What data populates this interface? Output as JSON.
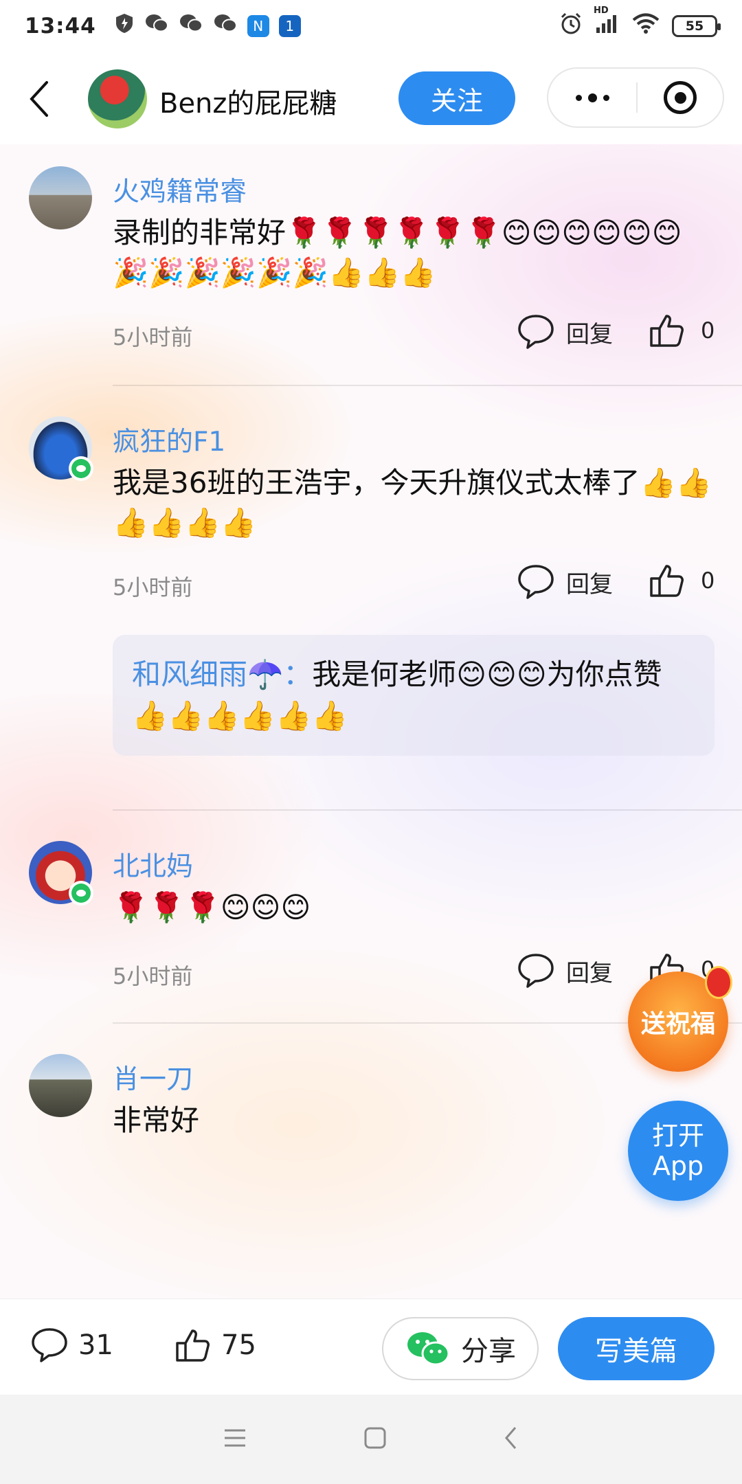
{
  "status_bar": {
    "time": "13:44",
    "battery": "55",
    "signal_label": "HD"
  },
  "header": {
    "back_icon": "chevron-left-icon",
    "author_name": "Benz的屁屁糖",
    "follow_label": "关注",
    "more_icon": "more-dots-icon",
    "close_icon": "target-close-icon"
  },
  "comments": [
    {
      "name": "火鸡籍常睿",
      "text": "录制的非常好🌹🌹🌹🌹🌹🌹😊😊😊😊😊😊🎉🎉🎉🎉🎉🎉👍👍👍",
      "time": "5小时前",
      "reply_label": "回复",
      "likes": "0"
    },
    {
      "name": "疯狂的F1",
      "text": "我是36班的王浩宇，今天升旗仪式太棒了👍👍👍👍👍👍",
      "time": "5小时前",
      "reply_label": "回复",
      "likes": "0",
      "sub_reply": {
        "who": "和风细雨☂️：",
        "text": "我是何老师😊😊😊为你点赞👍👍👍👍👍👍"
      }
    },
    {
      "name": "北北妈",
      "text": "🌹🌹🌹😊😊😊",
      "time": "5小时前",
      "reply_label": "回复",
      "likes": "0"
    },
    {
      "name": "肖一刀",
      "text": "非常好"
    }
  ],
  "floating": {
    "bless_label": "送祝福",
    "open_app_line1": "打开",
    "open_app_line2": "App"
  },
  "bottom_bar": {
    "comment_count": "31",
    "like_count": "75",
    "share_label": "分享",
    "write_label": "写美篇"
  },
  "colors": {
    "accent": "#2d8cf0",
    "name": "#4a90e2",
    "wechat": "#25c05f"
  }
}
